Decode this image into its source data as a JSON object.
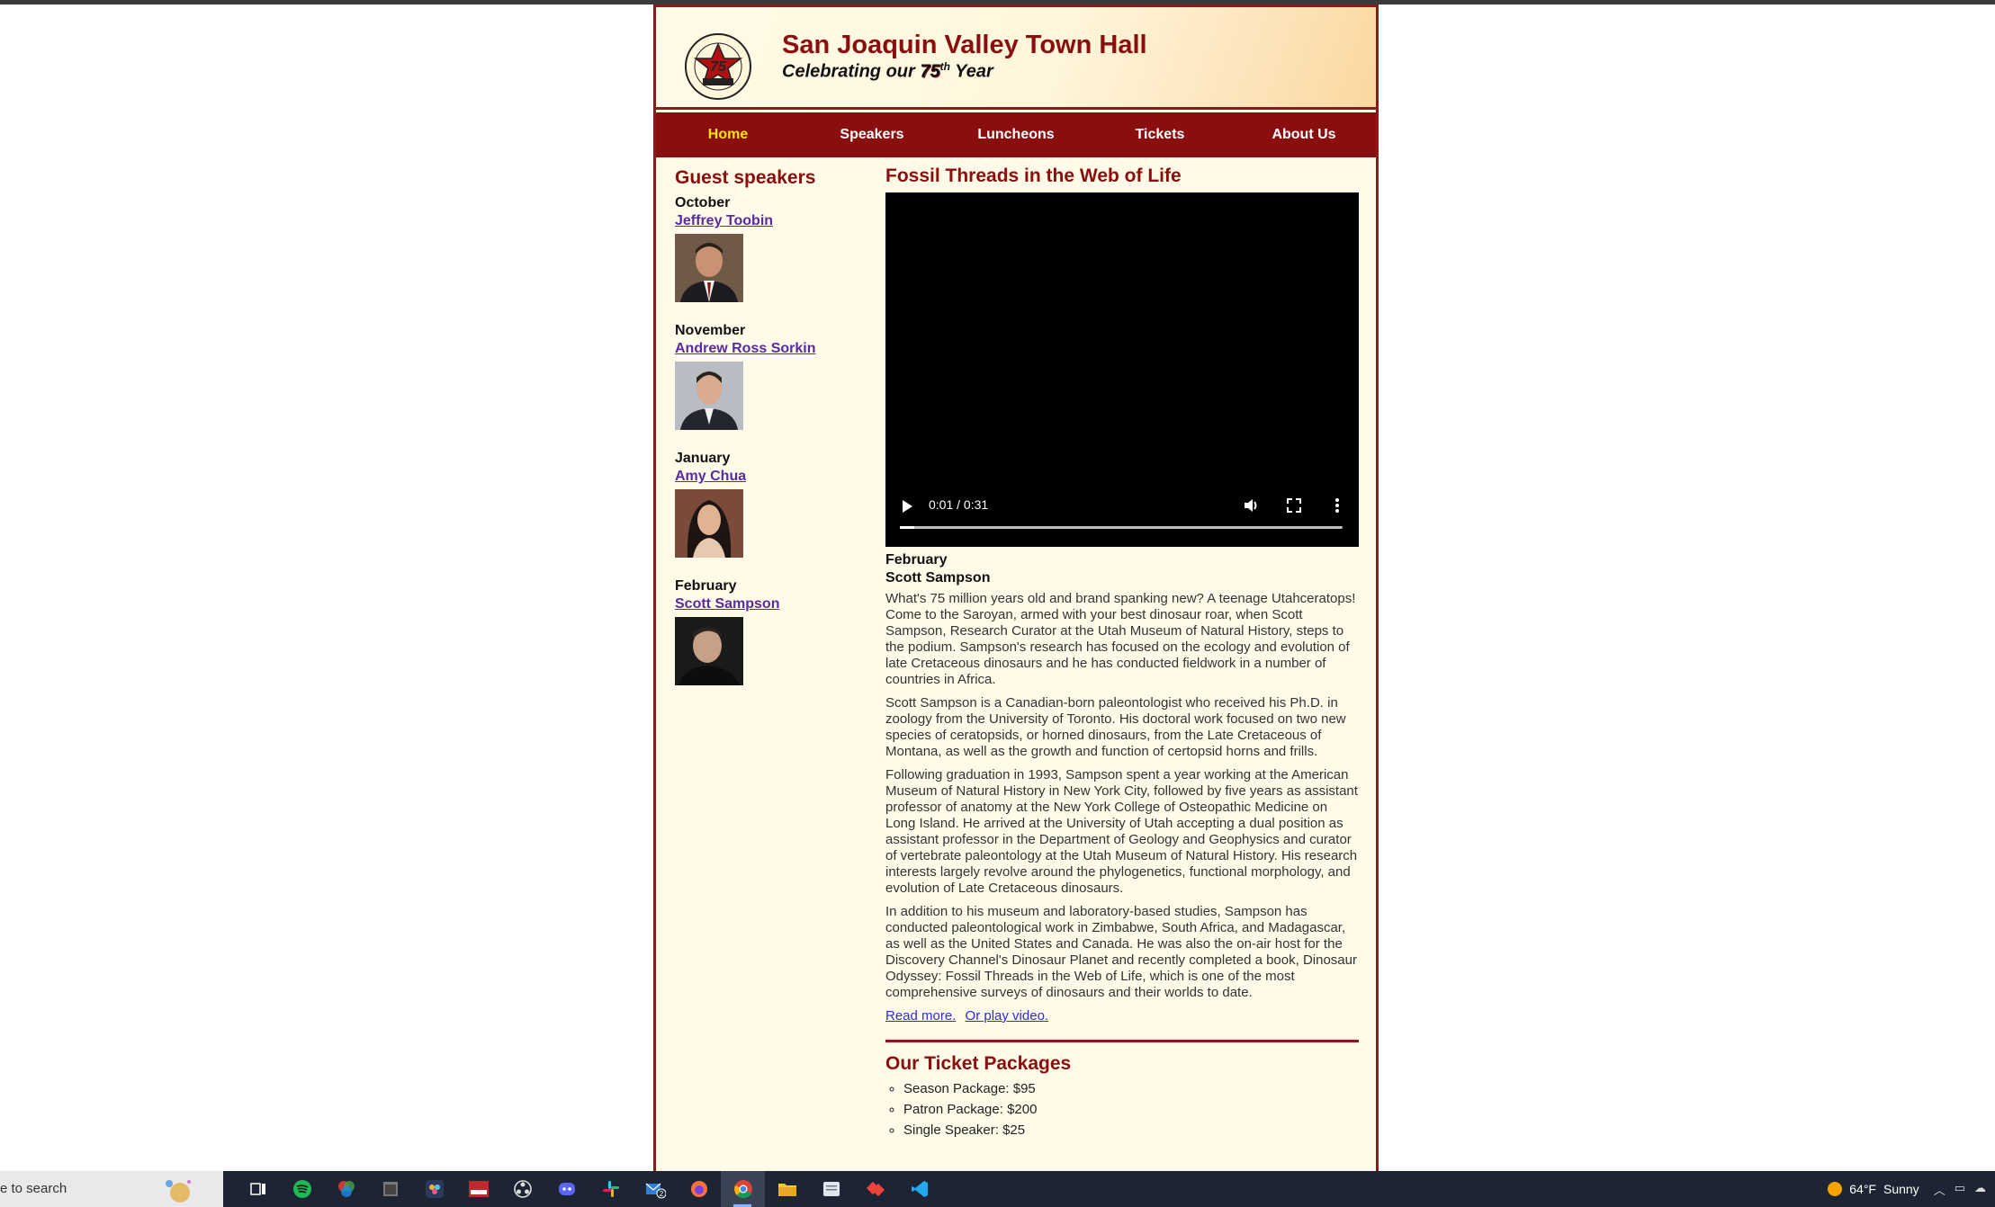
{
  "site": {
    "title": "San Joaquin Valley Town Hall",
    "subtitle_prefix": "Celebrating our ",
    "subtitle_number": "75",
    "subtitle_sup": "th",
    "subtitle_suffix": " Year"
  },
  "nav": [
    {
      "label": "Home",
      "active": true
    },
    {
      "label": "Speakers"
    },
    {
      "label": "Luncheons"
    },
    {
      "label": "Tickets"
    },
    {
      "label": "About Us"
    }
  ],
  "sidebar": {
    "heading": "Guest speakers",
    "speakers": [
      {
        "month": "October",
        "name": "Jeffrey Toobin"
      },
      {
        "month": "November",
        "name": "Andrew Ross Sorkin"
      },
      {
        "month": "January",
        "name": "Amy Chua"
      },
      {
        "month": "February",
        "name": "Scott Sampson"
      }
    ]
  },
  "main": {
    "heading": "Fossil Threads in the Web of Life",
    "video": {
      "time": "0:01 / 0:31",
      "progress": 0.032
    },
    "event_month": "February",
    "event_speaker": "Scott Sampson",
    "paragraphs": [
      "What's 75 million years old and brand spanking new? A teenage Utahceratops! Come to the Saroyan, armed with your best dinosaur roar, when Scott Sampson, Research Curator at the Utah Museum of Natural History, steps to the podium. Sampson's research has focused on the ecology and evolution of late Cretaceous dinosaurs and he has conducted fieldwork in a number of countries in Africa.",
      "Scott Sampson is a Canadian-born paleontologist who received his Ph.D. in zoology from the University of Toronto. His doctoral work focused on two new species of ceratopsids, or horned dinosaurs, from the Late Cretaceous of Montana, as well as the growth and function of certopsid horns and frills.",
      "Following graduation in 1993, Sampson spent a year working at the American Museum of Natural History in New York City, followed by five years as assistant professor of anatomy at the New York College of Osteopathic Medicine on Long Island. He arrived at the University of Utah accepting a dual position as assistant professor in the Department of Geology and Geophysics and curator of vertebrate paleontology at the Utah Museum of Natural History. His research interests largely revolve around the phylogenetics, functional morphology, and evolution of Late Cretaceous dinosaurs.",
      "In addition to his museum and laboratory-based studies, Sampson has conducted paleontological work in Zimbabwe, South Africa, and Madagascar, as well as the United States and Canada. He was also the on-air host for the Discovery Channel's Dinosaur Planet and recently completed a book, Dinosaur Odyssey: Fossil Threads in the Web of Life, which is one of the most comprehensive surveys of dinosaurs and their worlds to date."
    ],
    "read_more": "Read more.",
    "play_video": "Or play video.",
    "tickets_heading": "Our Ticket Packages",
    "tickets": [
      "Season Package: $95",
      "Patron Package: $200",
      "Single Speaker: $25"
    ]
  },
  "taskbar": {
    "search_text": "e to search",
    "temperature": "64°F",
    "weather": "Sunny"
  },
  "colors": {
    "brand": "#8b0e0e",
    "nav_active": "#ffe400",
    "link": "#5a2aa0"
  }
}
